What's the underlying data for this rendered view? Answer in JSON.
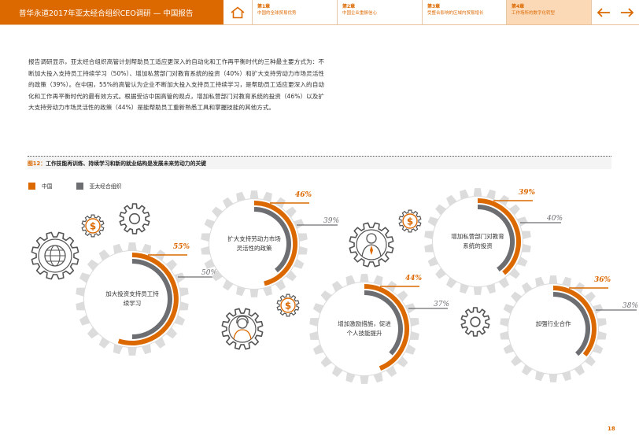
{
  "header": {
    "title": "普华永道2017年亚太经合组织CEO调研 — 中国报告",
    "chapters": [
      {
        "num": "第1章",
        "title": "中国的全球贸易优势",
        "active": false
      },
      {
        "num": "第2章",
        "title": "中国企业重振信心",
        "active": false
      },
      {
        "num": "第3章",
        "title": "受整合影响的区域内贸易增长",
        "active": false
      },
      {
        "num": "第4章",
        "title": "工作场所的数字化转型",
        "active": true
      }
    ]
  },
  "body_text": "报告调研显示，亚太经合组织高管计划帮助员工适应更深入的自动化和工作再平衡时代的三种最主要方式为：不断加大投入支持员工持续学习（50%）、增加私营部门对教育系统的投资（40%）和扩大支持劳动力市场灵活性的政策（39%）。在中国，55%的高管认为企业不断加大投入支持员工持续学习，是帮助员工适应更深入的自动化和工作再平衡时代的最有效方式。根据受访中国高管的观点，增加私营部门对教育系统的投资（46%）以及扩大支持劳动力市场灵活性的政策（44%）是能帮助员工重新熟悉工具和掌握技能的其他方式。",
  "figure": {
    "label": "图12：",
    "caption": "工作技能再训练、持续学习和新的就业结构是发展未来劳动力的关键"
  },
  "legend": [
    {
      "name": "中国",
      "color": "#dc6900"
    },
    {
      "name": "亚太经合组织",
      "color": "#6d6e71"
    }
  ],
  "chart_data": {
    "type": "gauge",
    "series_names": [
      "中国",
      "亚太经合组织"
    ],
    "items": [
      {
        "label": "加大投资支持员工持续学习",
        "china": 55,
        "apec": 50,
        "china_label": "55%",
        "apec_label": "50%"
      },
      {
        "label": "扩大支持劳动力市场灵活性的政策",
        "china": 46,
        "apec": 39,
        "china_label": "46%",
        "apec_label": "39%"
      },
      {
        "label": "增加激励措施，促进个人技能提升",
        "china": 44,
        "apec": 37,
        "china_label": "44%",
        "apec_label": "37%"
      },
      {
        "label": "增加私营部门对教育系统的投资",
        "china": 39,
        "apec": 40,
        "china_label": "39%",
        "apec_label": "40%"
      },
      {
        "label": "加强行业合作",
        "china": 36,
        "apec": 38,
        "china_label": "36%",
        "apec_label": "38%"
      }
    ]
  },
  "colors": {
    "accent": "#dc6900",
    "apec": "#6d6e71",
    "gear": "#dcdcdc"
  },
  "icons": [
    "home-icon",
    "arrow-left-icon",
    "arrow-right-icon",
    "globe-icon",
    "dollar-icon",
    "gear-icon",
    "businessman-icon",
    "businesswoman-icon"
  ],
  "page_number": "18"
}
